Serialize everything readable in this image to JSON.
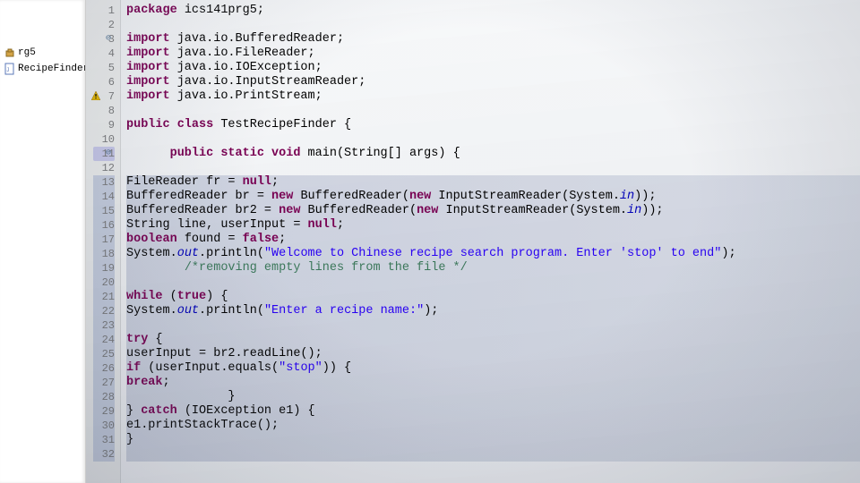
{
  "explorer": {
    "items": [
      {
        "label": "rg5"
      },
      {
        "label": "RecipeFinder.jav"
      }
    ]
  },
  "editor": {
    "lines": [
      {
        "n": 1,
        "segs": [
          [
            "kw",
            "package"
          ],
          [
            "plain",
            " ics141prg5;"
          ]
        ]
      },
      {
        "n": 2,
        "segs": []
      },
      {
        "n": 3,
        "mark": "fold",
        "segs": [
          [
            "kw",
            "import"
          ],
          [
            "plain",
            " java.io.BufferedReader;"
          ]
        ]
      },
      {
        "n": 4,
        "segs": [
          [
            "kw",
            "import"
          ],
          [
            "plain",
            " java.io.FileReader;"
          ]
        ]
      },
      {
        "n": 5,
        "segs": [
          [
            "kw",
            "import"
          ],
          [
            "plain",
            " java.io.IOException;"
          ]
        ]
      },
      {
        "n": 6,
        "segs": [
          [
            "kw",
            "import"
          ],
          [
            "plain",
            " java.io.InputStreamReader;"
          ]
        ]
      },
      {
        "n": 7,
        "mark": "warn",
        "segs": [
          [
            "kw",
            "import"
          ],
          [
            "plain",
            " java.io.PrintStream;"
          ]
        ]
      },
      {
        "n": 8,
        "segs": []
      },
      {
        "n": 9,
        "segs": [
          [
            "kw",
            "public class"
          ],
          [
            "plain",
            " TestRecipeFinder {"
          ]
        ]
      },
      {
        "n": 10,
        "segs": []
      },
      {
        "n": 11,
        "mark": "fold-hl",
        "segs": [
          [
            "plain",
            "      "
          ],
          [
            "kw",
            "public static void"
          ],
          [
            "plain",
            " main(String[] args) {"
          ]
        ]
      },
      {
        "n": 12,
        "segs": []
      },
      {
        "n": 13,
        "hl": true,
        "segs": [
          [
            "plain",
            "FileReader fr = "
          ],
          [
            "kw",
            "null"
          ],
          [
            "plain",
            ";"
          ]
        ]
      },
      {
        "n": 14,
        "hl": true,
        "segs": [
          [
            "plain",
            "BufferedReader br = "
          ],
          [
            "kw",
            "new"
          ],
          [
            "plain",
            " BufferedReader("
          ],
          [
            "kw",
            "new"
          ],
          [
            "plain",
            " InputStreamReader(System."
          ],
          [
            "field",
            "in"
          ],
          [
            "plain",
            "));"
          ]
        ]
      },
      {
        "n": 15,
        "hl": true,
        "segs": [
          [
            "plain",
            "BufferedReader br2 = "
          ],
          [
            "kw",
            "new"
          ],
          [
            "plain",
            " BufferedReader("
          ],
          [
            "kw",
            "new"
          ],
          [
            "plain",
            " InputStreamReader(System."
          ],
          [
            "field",
            "in"
          ],
          [
            "plain",
            "));"
          ]
        ]
      },
      {
        "n": 16,
        "hl": true,
        "segs": [
          [
            "plain",
            "String line, userInput = "
          ],
          [
            "kw",
            "null"
          ],
          [
            "plain",
            ";"
          ]
        ]
      },
      {
        "n": 17,
        "hl": true,
        "segs": [
          [
            "kw",
            "boolean"
          ],
          [
            "plain",
            " found = "
          ],
          [
            "kw",
            "false"
          ],
          [
            "plain",
            ";"
          ]
        ]
      },
      {
        "n": 18,
        "hl": true,
        "segs": [
          [
            "plain",
            "System."
          ],
          [
            "field",
            "out"
          ],
          [
            "plain",
            ".println("
          ],
          [
            "str",
            "\"Welcome to Chinese recipe search program. Enter 'stop' to end\""
          ],
          [
            "plain",
            ");"
          ]
        ]
      },
      {
        "n": 19,
        "hl": true,
        "segs": [
          [
            "plain",
            "        "
          ],
          [
            "cmt",
            "/*removing empty lines from the file */"
          ]
        ]
      },
      {
        "n": 20,
        "hl": true,
        "segs": []
      },
      {
        "n": 21,
        "hl": true,
        "segs": [
          [
            "kw",
            "while"
          ],
          [
            "plain",
            " ("
          ],
          [
            "kw",
            "true"
          ],
          [
            "plain",
            ") {"
          ]
        ]
      },
      {
        "n": 22,
        "hl": true,
        "segs": [
          [
            "plain",
            "System."
          ],
          [
            "field",
            "out"
          ],
          [
            "plain",
            ".println("
          ],
          [
            "str",
            "\"Enter a recipe name:\""
          ],
          [
            "plain",
            ");"
          ]
        ]
      },
      {
        "n": 23,
        "hl": true,
        "segs": []
      },
      {
        "n": 24,
        "hl": true,
        "segs": [
          [
            "kw",
            "try"
          ],
          [
            "plain",
            " {"
          ]
        ]
      },
      {
        "n": 25,
        "hl": true,
        "segs": [
          [
            "plain",
            "userInput = br2.readLine();"
          ]
        ]
      },
      {
        "n": 26,
        "hl": true,
        "segs": [
          [
            "kw",
            "if"
          ],
          [
            "plain",
            " (userInput.equals("
          ],
          [
            "str",
            "\"stop\""
          ],
          [
            "plain",
            ")) {"
          ]
        ]
      },
      {
        "n": 27,
        "hl": true,
        "segs": [
          [
            "kw",
            "break"
          ],
          [
            "plain",
            ";"
          ]
        ]
      },
      {
        "n": 28,
        "hl": true,
        "segs": [
          [
            "plain",
            "              }"
          ]
        ]
      },
      {
        "n": 29,
        "hl": true,
        "segs": [
          [
            "plain",
            "} "
          ],
          [
            "kw",
            "catch"
          ],
          [
            "plain",
            " (IOException e1) {"
          ]
        ]
      },
      {
        "n": 30,
        "hl": true,
        "segs": [
          [
            "plain",
            "e1.printStackTrace();"
          ]
        ]
      },
      {
        "n": 31,
        "hl": true,
        "segs": [
          [
            "plain",
            "}"
          ]
        ]
      },
      {
        "n": 32,
        "hl": true,
        "segs": []
      }
    ]
  }
}
